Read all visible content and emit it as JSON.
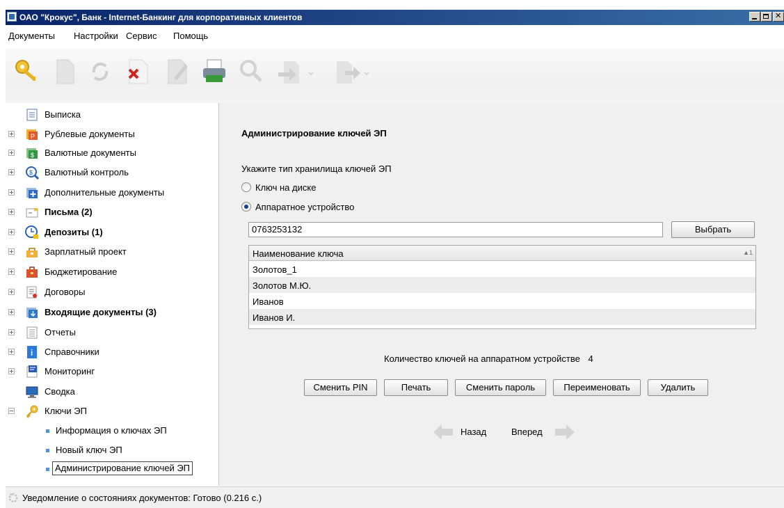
{
  "window": {
    "title": "ОАО \"Крокус\", Банк - Internet-Банкинг для корпоративных клиентов"
  },
  "menu": [
    "Документы",
    "Настройки",
    "Сервис",
    "Помощь"
  ],
  "toolbar": {
    "icons": [
      "keys-icon",
      "document-icon",
      "refresh-icon",
      "delete-icon",
      "edit-icon",
      "print-icon",
      "search-icon",
      "export-icon",
      "send-icon"
    ]
  },
  "sidebar": {
    "items": [
      {
        "label": "Выписка",
        "icon": "statement-icon",
        "expander": "none",
        "bold": false
      },
      {
        "label": "Рублевые документы",
        "icon": "ruble-docs-icon",
        "expander": "plus",
        "bold": false
      },
      {
        "label": "Валютные документы",
        "icon": "currency-docs-icon",
        "expander": "plus",
        "bold": false
      },
      {
        "label": "Валютный контроль",
        "icon": "currency-control-icon",
        "expander": "plus",
        "bold": false
      },
      {
        "label": "Дополнительные документы",
        "icon": "additional-docs-icon",
        "expander": "plus",
        "bold": false
      },
      {
        "label": "Письма (2)",
        "icon": "letters-icon",
        "expander": "plus",
        "bold": true
      },
      {
        "label": "Депозиты (1)",
        "icon": "deposits-icon",
        "expander": "plus",
        "bold": true
      },
      {
        "label": "Зарплатный проект",
        "icon": "salary-icon",
        "expander": "plus",
        "bold": false
      },
      {
        "label": "Бюджетирование",
        "icon": "budget-icon",
        "expander": "plus",
        "bold": false
      },
      {
        "label": "Договоры",
        "icon": "contracts-icon",
        "expander": "plus",
        "bold": false
      },
      {
        "label": "Входящие документы (3)",
        "icon": "incoming-docs-icon",
        "expander": "plus",
        "bold": true
      },
      {
        "label": "Отчеты",
        "icon": "reports-icon",
        "expander": "plus",
        "bold": false
      },
      {
        "label": "Справочники",
        "icon": "info-icon",
        "expander": "plus",
        "bold": false
      },
      {
        "label": "Мониторинг",
        "icon": "monitoring-icon",
        "expander": "plus",
        "bold": false
      },
      {
        "label": "Сводка",
        "icon": "summary-icon",
        "expander": "none",
        "bold": false
      },
      {
        "label": "Ключи ЭП",
        "icon": "key-icon",
        "expander": "minus",
        "bold": false
      }
    ],
    "subitems": [
      {
        "label": "Информация о ключах ЭП",
        "selected": false
      },
      {
        "label": "Новый ключ ЭП",
        "selected": false
      },
      {
        "label": "Администрирование ключей ЭП",
        "selected": true
      }
    ]
  },
  "main": {
    "heading": "Администрирование ключей ЭП",
    "prompt": "Укажите тип хранилища ключей ЭП",
    "radio_disk": "Ключ на диске",
    "radio_device": "Аппаратное устройство",
    "device_value": "0763253132",
    "select_button": "Выбрать",
    "table": {
      "column": "Наименование ключа",
      "sort_indicator": "▲1",
      "rows": [
        "Золотов_1",
        "Золотов М.Ю.",
        "Иванов",
        "Иванов И."
      ]
    },
    "count_text": "Количество ключей на аппаратном устройстве",
    "count_value": "4",
    "buttons": {
      "change_pin": "Сменить PIN",
      "print": "Печать",
      "change_password": "Сменить пароль",
      "rename": "Переименовать",
      "delete": "Удалить"
    },
    "nav": {
      "back": "Назад",
      "forward": "Вперед"
    }
  },
  "status": {
    "text": "Уведомление о состояниях документов: Готово (0.216 с.)"
  }
}
